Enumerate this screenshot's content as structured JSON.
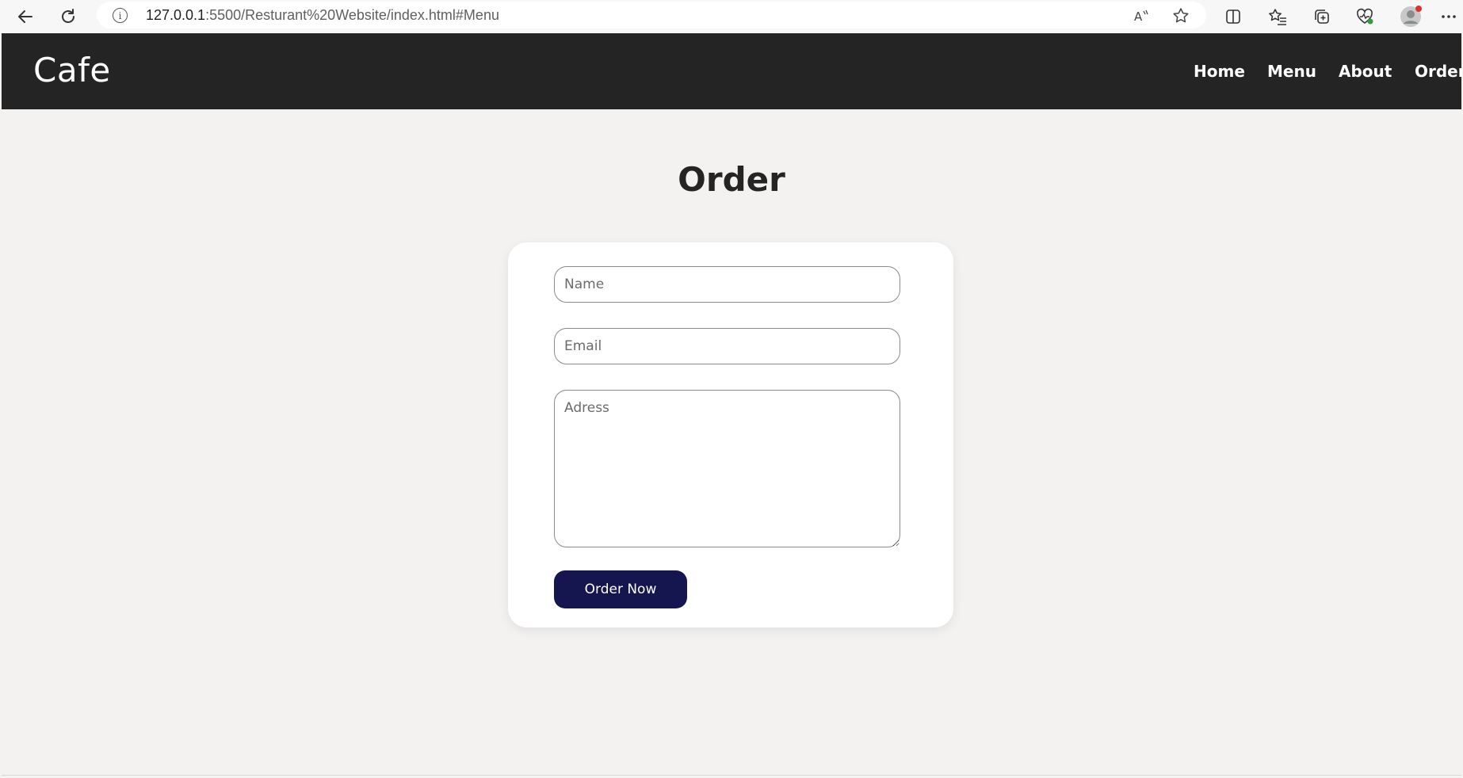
{
  "browser": {
    "url_host": "127.0.0.1",
    "url_rest": ":5500/Resturant%20Website/index.html#Menu",
    "icons": [
      "back-icon",
      "refresh-icon",
      "info-icon",
      "read-aloud-icon",
      "favorite-star-icon",
      "split-screen-icon",
      "favorites-icon",
      "collections-icon",
      "browser-essentials-icon",
      "profile-avatar-icon",
      "more-icon"
    ]
  },
  "navbar": {
    "brand": "Cafe",
    "links": [
      "Home",
      "Menu",
      "About",
      "Order"
    ]
  },
  "order": {
    "heading": "Order",
    "name_placeholder": "Name",
    "email_placeholder": "Email",
    "address_placeholder": "Adress",
    "button_label": "Order Now"
  },
  "colors": {
    "navbar_bg": "#242424",
    "page_bg": "#f3f2f1",
    "button_bg": "#15154f"
  }
}
